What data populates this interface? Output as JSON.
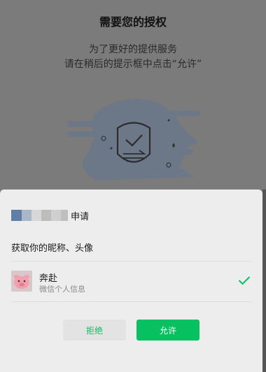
{
  "background": {
    "title": "需要您的授权",
    "lines": [
      "为了更好的提供服务",
      "请在稍后的提示框中点击“允许”"
    ],
    "illustration_icon": "shield-check-icon"
  },
  "sheet": {
    "app_name_blurred": true,
    "app_suffix": "申请",
    "scope_text": "获取你的昵称、头像",
    "account": {
      "name": "奔赴",
      "description": "微信个人信息",
      "avatar_icon": "pink-avatar-icon",
      "selected_icon": "checkmark-icon"
    },
    "buttons": {
      "reject": "拒绝",
      "allow": "允许"
    }
  },
  "colors": {
    "accent": "#07c160",
    "sheet_bg": "#ededed",
    "overlay": "#7b7b7b"
  }
}
